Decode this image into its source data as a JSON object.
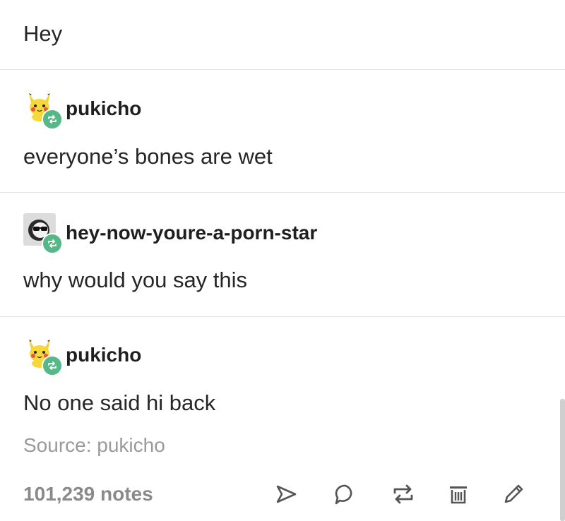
{
  "post": {
    "original_text": "Hey",
    "reblogs": [
      {
        "username": "pukicho",
        "avatar": "pikachu-avatar",
        "text": "everyone’s bones are wet"
      },
      {
        "username": "hey-now-youre-a-porn-star",
        "avatar": "sunglasses-avatar",
        "text": "why would you say this"
      },
      {
        "username": "pukicho",
        "avatar": "pikachu-avatar",
        "text": "No one said hi back"
      }
    ],
    "source": "Source: pukicho",
    "notes": "101,239 notes",
    "actions": [
      "share-icon",
      "reply-icon",
      "reblog-icon",
      "delete-icon",
      "edit-icon"
    ],
    "colors": {
      "text": "#262626",
      "muted": "#9a9a9a",
      "reblog_badge": "#56b887",
      "icon": "#555555"
    }
  }
}
